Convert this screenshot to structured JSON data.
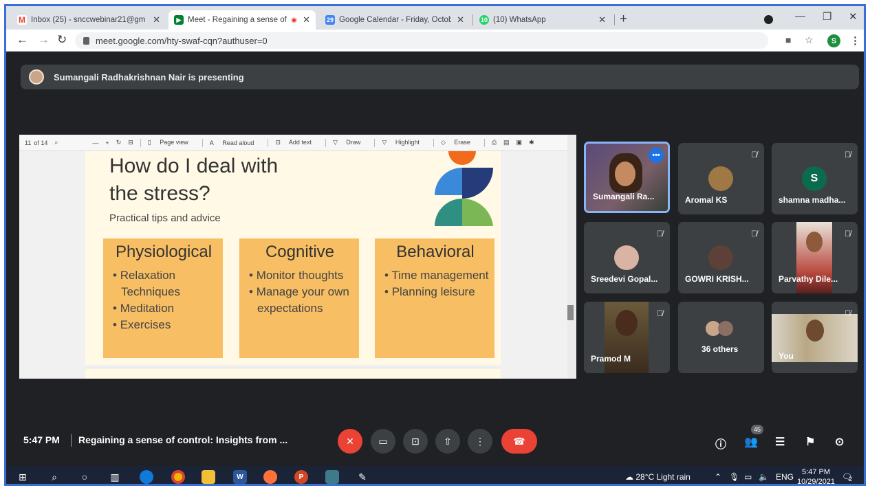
{
  "browser": {
    "tabs": [
      {
        "label": "Inbox (25) - snccwebinar21@gm",
        "icon": "gmail-icon",
        "color": "#ea4335"
      },
      {
        "label": "Meet - Regaining a sense of",
        "icon": "meet-icon",
        "color": "#00832d"
      },
      {
        "label": "Google Calendar - Friday, Octobe",
        "icon": "calendar-icon",
        "color": "#4285f4"
      },
      {
        "label": "(10) WhatsApp",
        "icon": "whatsapp-icon",
        "color": "#25d366"
      }
    ],
    "calendar_icon_text": "29",
    "whatsapp_icon_text": "10",
    "url": "meet.google.com/hty-swaf-cqn?authuser=0",
    "profile_initial": "S"
  },
  "meet": {
    "presenting_text": "Sumangali Radhakrishnan Nair is presenting",
    "time": "5:47 PM",
    "meeting_name": "Regaining a sense of control: Insights from ...",
    "participant_count": "45",
    "tiles": [
      {
        "name": "Sumangali Ra..."
      },
      {
        "name": "Aromal KS"
      },
      {
        "name": "shamna madha...",
        "initial": "S"
      },
      {
        "name": "Sreedevi Gopal..."
      },
      {
        "name": "GOWRI KRISH..."
      },
      {
        "name": "Parvathy Dile..."
      },
      {
        "name": "Pramod M"
      },
      {
        "name": "36 others"
      },
      {
        "name": "You"
      }
    ]
  },
  "pdf": {
    "page": "11",
    "page_total": "of 14",
    "page_view": "Page view",
    "read_aloud": "Read aloud",
    "add_text": "Add text",
    "draw": "Draw",
    "highlight": "Highlight",
    "erase": "Erase"
  },
  "slide": {
    "title_line1": "How do I deal with",
    "title_line2": "the stress?",
    "subtitle": "Practical tips and advice",
    "cards": [
      {
        "heading": "Physiological",
        "items": [
          "Relaxation Techniques",
          "Meditation",
          "Exercises"
        ]
      },
      {
        "heading": "Cognitive",
        "items": [
          "Monitor thoughts",
          "Manage your own expectations"
        ]
      },
      {
        "heading": "Behavioral",
        "items": [
          "Time management",
          "Planning leisure"
        ]
      }
    ]
  },
  "taskbar": {
    "weather": "28°C  Light rain",
    "lang": "ENG",
    "time": "5:47 PM",
    "date": "10/29/2021",
    "notif_count": "2",
    "word_letter": "W",
    "ppt_letter": "P"
  }
}
